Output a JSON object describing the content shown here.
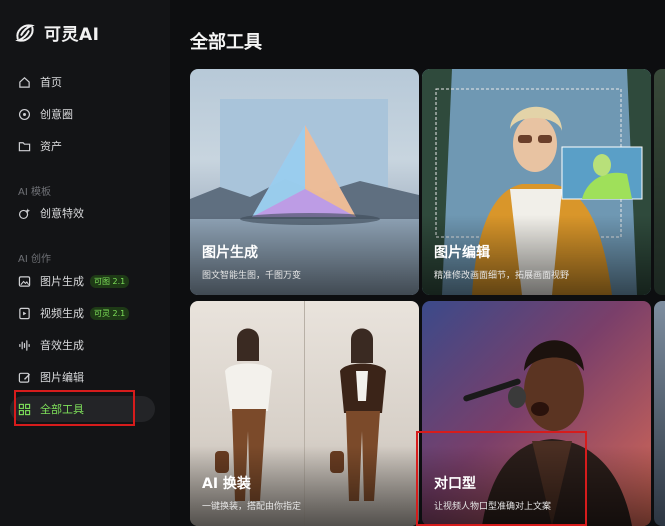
{
  "app": {
    "name": "可灵AI"
  },
  "sidebar": {
    "top_items": [
      {
        "label": "首页",
        "icon": "home-icon"
      },
      {
        "label": "创意圈",
        "icon": "compass-icon"
      },
      {
        "label": "资产",
        "icon": "folder-icon"
      }
    ],
    "sections": [
      {
        "title": "AI 模板",
        "items": [
          {
            "label": "创意特效",
            "icon": "sparkle-icon"
          }
        ]
      },
      {
        "title": "AI 创作",
        "items": [
          {
            "label": "图片生成",
            "icon": "image-icon",
            "badge": "可图 2.1"
          },
          {
            "label": "视频生成",
            "icon": "video-icon",
            "badge": "可灵 2.1"
          },
          {
            "label": "音效生成",
            "icon": "audio-wave-icon"
          },
          {
            "label": "图片编辑",
            "icon": "image-edit-icon"
          },
          {
            "label": "全部工具",
            "icon": "grid-icon",
            "active": true
          }
        ]
      }
    ]
  },
  "main": {
    "title": "全部工具",
    "cards": [
      {
        "title": "图片生成",
        "desc": "图文智能生图，千图万变"
      },
      {
        "title": "图片编辑",
        "desc": "精准修改画面细节，拓展画面视野"
      },
      {
        "title": "AI 换装",
        "desc": "一键换装，搭配由你指定"
      },
      {
        "title": "对口型",
        "desc": "让视频人物口型准确对上文案"
      }
    ]
  },
  "colors": {
    "accent": "#7ee05a",
    "highlight": "#d61c1c",
    "sidebar_bg": "#131416",
    "page_bg": "#0d0e10"
  }
}
